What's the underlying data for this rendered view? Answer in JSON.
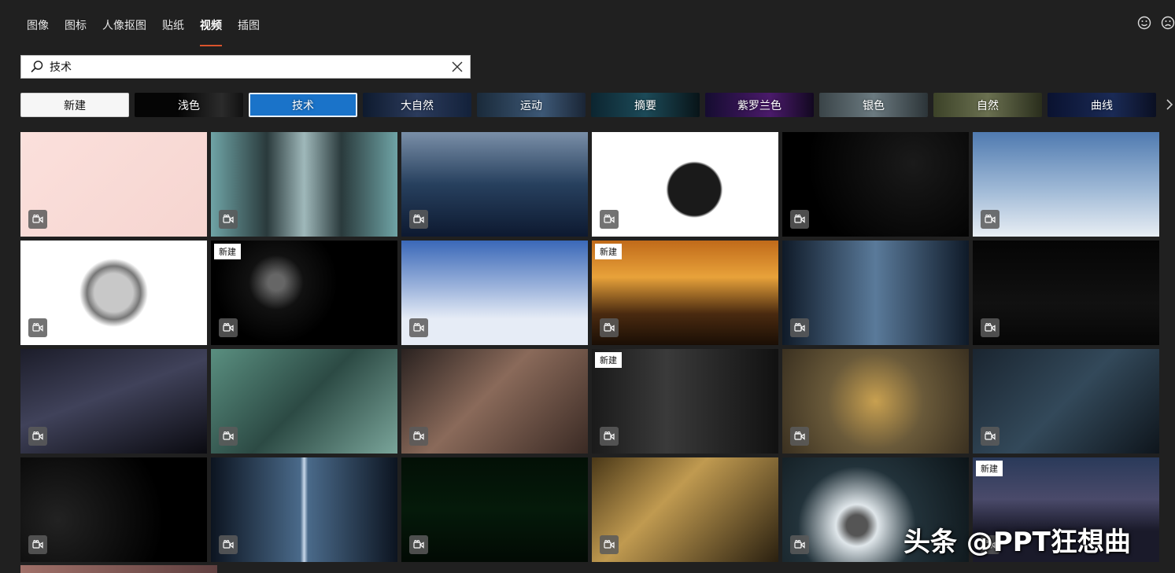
{
  "tabs": [
    {
      "label": "图像",
      "active": false
    },
    {
      "label": "图标",
      "active": false
    },
    {
      "label": "人像抠图",
      "active": false
    },
    {
      "label": "贴纸",
      "active": false
    },
    {
      "label": "视频",
      "active": true
    },
    {
      "label": "插图",
      "active": false
    }
  ],
  "search": {
    "value": "技术"
  },
  "chips": [
    {
      "label": "新建",
      "kind": "new"
    },
    {
      "label": "浅色",
      "bg": "linear-gradient(90deg,#050505 40%,#2b2b2b 80%,#111)"
    },
    {
      "label": "技术",
      "active": true
    },
    {
      "label": "大自然",
      "bg": "linear-gradient(90deg,#0e1a2e,#2b3b5c 50%,#13213a)"
    },
    {
      "label": "运动",
      "bg": "linear-gradient(90deg,#1a2a3a,#3d5876 60%,#1a2535)"
    },
    {
      "label": "摘要",
      "bg": "linear-gradient(90deg,#0c2530,#1c4a58 50%,#081418)"
    },
    {
      "label": "紫罗兰色",
      "bg": "linear-gradient(90deg,#150c30,#4a1a6a 60%,#120820)"
    },
    {
      "label": "银色",
      "bg": "linear-gradient(90deg,#3a4448,#6b7a80 50%,#2c3438)"
    },
    {
      "label": "自然",
      "bg": "linear-gradient(90deg,#3c4228,#6a7050 50%,#2a2e1c)"
    },
    {
      "label": "曲线",
      "bg": "linear-gradient(90deg,#0a1230,#1a2a55 60%,#0a0f22)"
    }
  ],
  "new_badge_label": "新建",
  "tiles": [
    {
      "name": "desk-illustration",
      "bg": "linear-gradient(135deg,#fbe0dc,#f6d5d0)",
      "new": false
    },
    {
      "name": "escalator",
      "bg": "linear-gradient(90deg,#6fa4a6,#2a3a3c 30%,#9fb8ba 50%,#2a3a3c 70%,#6fa4a6)",
      "new": false
    },
    {
      "name": "conveyor-boxes",
      "bg": "linear-gradient(180deg,#7a8fa8,#27405e 50%,#0d1930)",
      "new": false
    },
    {
      "name": "telephone",
      "bg": "radial-gradient(circle at 55% 55%,#1a1a1a 22%,#ffffff 24%)",
      "new": false
    },
    {
      "name": "speedometer",
      "bg": "radial-gradient(circle at 70% 30%,#1a1a1a,#000 70%)",
      "new": false
    },
    {
      "name": "airplane-wing",
      "bg": "linear-gradient(180deg,#4f7ab0,#9fb9d6 55%,#e8eef4)",
      "new": false
    },
    {
      "name": "gears-sphere",
      "bg": "radial-gradient(circle at 50% 50%,#c8c8c8 18%,#777 25%,#ffffff 32%)",
      "new": false
    },
    {
      "name": "microphone",
      "bg": "radial-gradient(circle at 35% 40%,#666 6%,#111 20%,#000 45%)",
      "new": true
    },
    {
      "name": "jet-clouds",
      "bg": "linear-gradient(180deg,#3a68b8,#9db4dc 45%,#e6ecf6 75%)",
      "new": false
    },
    {
      "name": "city-train-sunset",
      "bg": "linear-gradient(180deg,#c06a1a,#e8a23a 35%,#4a2a10 70%,#1a0e05)",
      "new": true
    },
    {
      "name": "server-room",
      "bg": "linear-gradient(90deg,#0f1a28,#5a7a9a 50%,#0f1a28)",
      "new": false
    },
    {
      "name": "light-bulbs",
      "bg": "linear-gradient(180deg,#050505,#111 60%,#060606)",
      "new": false
    },
    {
      "name": "typing-hand",
      "bg": "linear-gradient(160deg,#1c1d2a,#40425a 45%,#0a0a10)",
      "new": false
    },
    {
      "name": "circuit-board",
      "bg": "linear-gradient(135deg,#5a8f80,#2c4a44 50%,#7aa59a)",
      "new": false
    },
    {
      "name": "bike-chain",
      "bg": "linear-gradient(135deg,#2a2220,#8a6a5a 45%,#3a2a24)",
      "new": false
    },
    {
      "name": "film-projector",
      "bg": "linear-gradient(90deg,#1a1a1a,#3a3a3a 40%,#111)",
      "new": true
    },
    {
      "name": "clock-gears",
      "bg": "radial-gradient(circle at 50% 50%,#c8a050,#6a5a3a 45%,#3a3020)",
      "new": false
    },
    {
      "name": "padlock-circuit",
      "bg": "linear-gradient(135deg,#1a2530,#33495a 50%,#0e151c)",
      "new": false
    },
    {
      "name": "rpm-gauge",
      "bg": "radial-gradient(circle at 20% 60%,#222,#000 65%)",
      "new": false
    },
    {
      "name": "datacenter-aisle",
      "bg": "linear-gradient(90deg,#0c1420,#4a6a8a 48%,#c8d8ea 50%,#4a6a8a 52%,#0c1420)",
      "new": false
    },
    {
      "name": "ecg-monitor",
      "bg": "linear-gradient(180deg,#031006,#051a0a 50%,#020a04)",
      "new": false
    },
    {
      "name": "golden-gears",
      "bg": "linear-gradient(135deg,#4a3818,#c09a50 40%,#2a2010)",
      "new": false
    },
    {
      "name": "camera-lens",
      "bg": "radial-gradient(circle at 40% 65%,#555 8%,#dfe6ea 16%,#22323a 45%,#0c1418)",
      "new": false
    },
    {
      "name": "city-night",
      "bg": "linear-gradient(180deg,#2a3a5a,#4a4a6a 40%,#1a1a2a 70%)",
      "new": true
    }
  ],
  "watermark": "头条 @PPT狂想曲"
}
